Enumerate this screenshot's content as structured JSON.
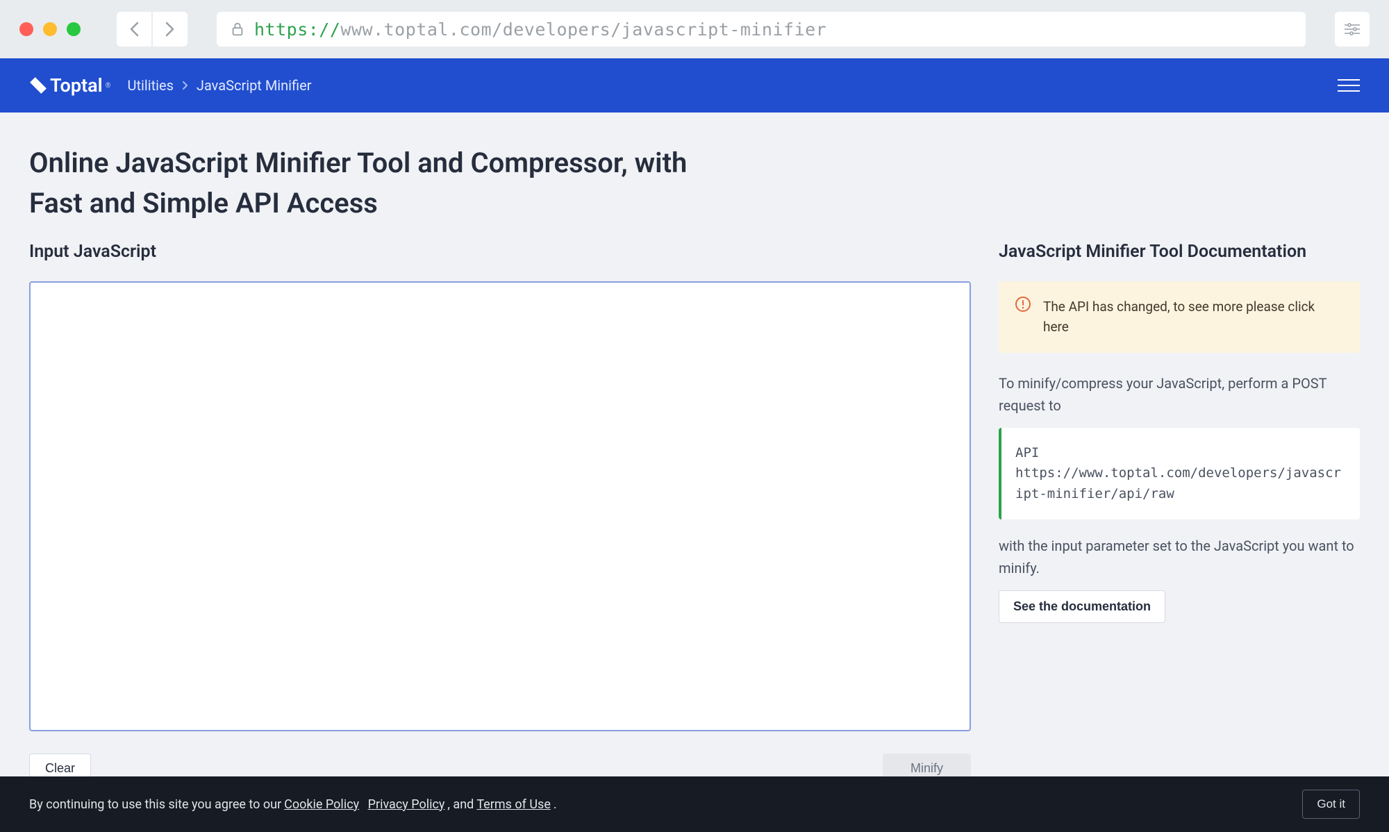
{
  "browser": {
    "url_scheme": "https://",
    "url_rest": "www.toptal.com/developers/javascript-minifier"
  },
  "header": {
    "logo_text": "Toptal",
    "breadcrumbs": [
      "Utilities",
      "JavaScript Minifier"
    ]
  },
  "main": {
    "title": "Online JavaScript Minifier Tool and Compressor, with Fast and Simple API Access",
    "input_heading": "Input JavaScript",
    "textarea_value": "",
    "clear_label": "Clear",
    "minify_label": "Minify"
  },
  "docs": {
    "heading": "JavaScript Minifier Tool Documentation",
    "alert": "The API has changed, to see more please click here",
    "para1": "To minify/compress your JavaScript, perform a POST request to",
    "code": "API\nhttps://www.toptal.com/developers/javascript-minifier/api/raw",
    "para2": "with the input parameter set to the JavaScript you want to minify.",
    "button": "See the documentation"
  },
  "cookie": {
    "text_pre": "By continuing to use this site you agree to our ",
    "cookie_policy": "Cookie Policy",
    "privacy_policy": "Privacy Policy",
    "between": ", and ",
    "terms": "Terms of Use",
    "dot": ".",
    "gotit": "Got it"
  }
}
